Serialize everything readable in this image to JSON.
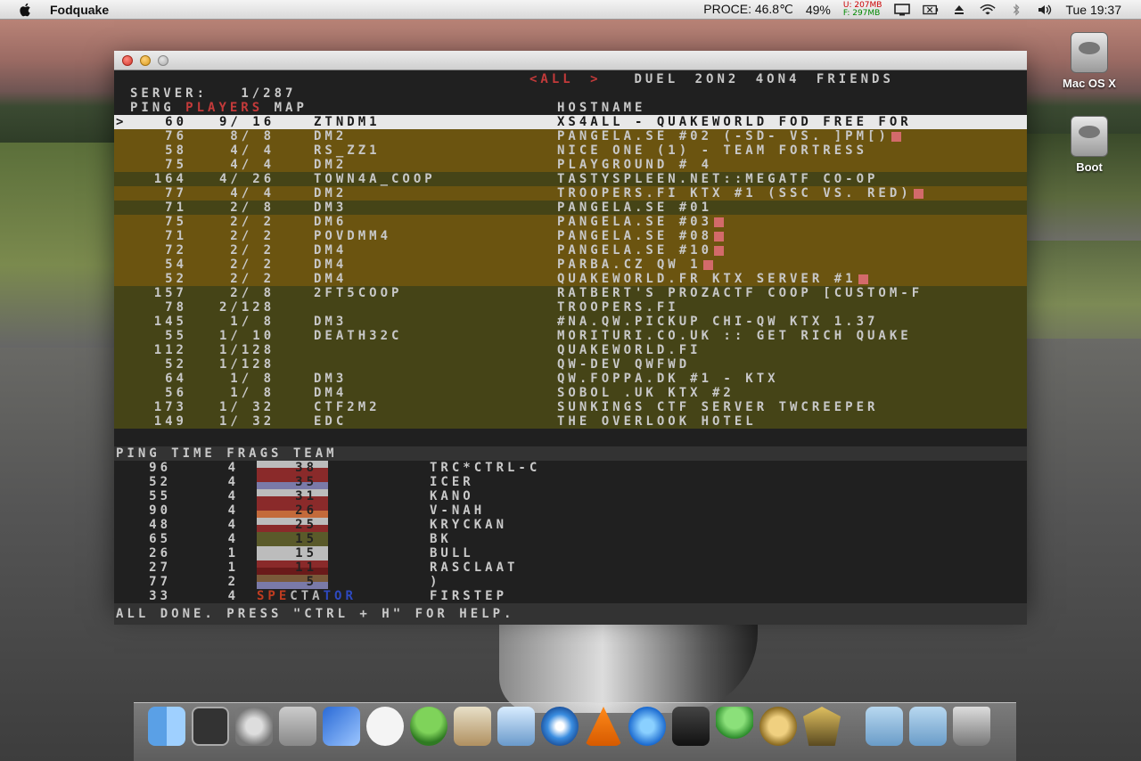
{
  "menubar": {
    "app_name": "Fodquake",
    "cpu": "PROCE: 46.8℃",
    "battery": "49%",
    "mem_used": "U: 207MB",
    "mem_free": "F: 297MB",
    "clock": "Tue 19:37"
  },
  "desktop": {
    "icons": [
      {
        "label": "Mac OS X"
      },
      {
        "label": "Boot"
      }
    ]
  },
  "browser": {
    "tabs": [
      "<ALL >",
      "DUEL",
      "2ON2",
      "4ON4",
      "FRIENDS"
    ],
    "server_label": "SERVER:",
    "server_count": "1/287",
    "headers": {
      "ping": "PING",
      "players": "PLAYERS",
      "map": "MAP",
      "hostname": "HOSTNAME"
    },
    "servers": [
      {
        "ping": "60",
        "players": "9/ 16",
        "map": "ZTNDM1",
        "host": "XS4ALL - QuakeWorld FOD Free For",
        "flag": false,
        "style": "sel"
      },
      {
        "ping": "76",
        "players": "8/ 8",
        "map": "DM2",
        "host": "pangela.se #02 (-sd- vs. ]pm[)",
        "flag": true,
        "style": "bg-y"
      },
      {
        "ping": "58",
        "players": "4/ 4",
        "map": "RS_ZZ1",
        "host": "Nice One (1) - Team Fortress",
        "flag": false,
        "style": "bg-y"
      },
      {
        "ping": "75",
        "players": "4/ 4",
        "map": "DM2",
        "host": "PlayGround # 4",
        "flag": false,
        "style": "bg-y"
      },
      {
        "ping": "164",
        "players": "4/ 26",
        "map": "TOWN4A_COOP",
        "host": "tastyspleen.net::MegaTF Co-Op",
        "flag": false,
        "style": "bg-o"
      },
      {
        "ping": "77",
        "players": "4/ 4",
        "map": "DM2",
        "host": "Troopers.fi KTX #1 (ssc vs. red)",
        "flag": true,
        "style": "bg-y"
      },
      {
        "ping": "71",
        "players": "2/ 8",
        "map": "DM3",
        "host": "pangela.se #01",
        "flag": false,
        "style": "bg-o"
      },
      {
        "ping": "75",
        "players": "2/ 2",
        "map": "DM6",
        "host": "pangela.se #03",
        "flag": true,
        "style": "bg-y"
      },
      {
        "ping": "71",
        "players": "2/ 2",
        "map": "POVDMM4",
        "host": "pangela.se #08",
        "flag": true,
        "style": "bg-y"
      },
      {
        "ping": "72",
        "players": "2/ 2",
        "map": "DM4",
        "host": "pangela.se #10",
        "flag": true,
        "style": "bg-y"
      },
      {
        "ping": "54",
        "players": "2/ 2",
        "map": "DM4",
        "host": "Parba.cz QW 1",
        "flag": true,
        "style": "bg-y"
      },
      {
        "ping": "52",
        "players": "2/ 2",
        "map": "DM4",
        "host": "QuakeWorld.fr KTX Server #1",
        "flag": true,
        "style": "bg-y"
      },
      {
        "ping": "157",
        "players": "2/ 8",
        "map": "2FT5COOP",
        "host": "Ratbert's ProZacTF Coop [Custom-F",
        "flag": false,
        "style": "bg-o"
      },
      {
        "ping": "78",
        "players": "2/128",
        "map": "",
        "host": "troopers.fi",
        "flag": false,
        "style": "bg-o"
      },
      {
        "ping": "145",
        "players": "1/ 8",
        "map": "DM3",
        "host": "#NA.QW.PICKUP CHI-QW KTX 1.37",
        "flag": false,
        "style": "bg-o"
      },
      {
        "ping": "55",
        "players": "1/ 10",
        "map": "DEATH32C",
        "host": "Moriturі.co.uk :: Get Rich Quake",
        "flag": false,
        "style": "bg-o"
      },
      {
        "ping": "112",
        "players": "1/128",
        "map": "",
        "host": "quakeworld.fi",
        "flag": false,
        "style": "bg-o"
      },
      {
        "ping": "52",
        "players": "1/128",
        "map": "",
        "host": "QW-DEV QWFWD",
        "flag": false,
        "style": "bg-o"
      },
      {
        "ping": "64",
        "players": "1/ 8",
        "map": "DM3",
        "host": "qw.foppa.dk #1 - ktx",
        "flag": false,
        "style": "bg-o"
      },
      {
        "ping": "56",
        "players": "1/ 8",
        "map": "DM4",
        "host": "Sobol .UK KTX #2",
        "flag": false,
        "style": "bg-o"
      },
      {
        "ping": "173",
        "players": "1/ 32",
        "map": "CTF2M2",
        "host": "Sunkings CTF Server TWCreeper",
        "flag": false,
        "style": "bg-o"
      },
      {
        "ping": "149",
        "players": "1/ 32",
        "map": "EDC",
        "host": "The Overlook Hotel",
        "flag": false,
        "style": "bg-o"
      }
    ],
    "player_headers": "PING TIME FRAGS TEAM",
    "players": [
      {
        "ping": "96",
        "time": "4",
        "frags": "38",
        "name": "TRC*Ctrl-C",
        "top": "#bcbcbc",
        "bot": "#8a2a2a"
      },
      {
        "ping": "52",
        "time": "4",
        "frags": "35",
        "name": "icer",
        "top": "#8a2a2a",
        "bot": "#7a7aa8"
      },
      {
        "ping": "55",
        "time": "4",
        "frags": "31",
        "name": "kano",
        "top": "#bcbcbc",
        "bot": "#8a2a2a"
      },
      {
        "ping": "90",
        "time": "4",
        "frags": "26",
        "name": "V-nah",
        "top": "#8a2a2a",
        "bot": "#c36a3a"
      },
      {
        "ping": "48",
        "time": "4",
        "frags": "25",
        "name": "kryckan",
        "top": "#bcbcbc",
        "bot": "#8a2a2a"
      },
      {
        "ping": "65",
        "time": "4",
        "frags": "15",
        "name": "bk",
        "top": "#5a5a2a",
        "bot": "#5a5a2a"
      },
      {
        "ping": "26",
        "time": "1",
        "frags": "15",
        "name": "bull",
        "top": "#bcbcbc",
        "bot": "#bcbcbc"
      },
      {
        "ping": "27",
        "time": "1",
        "frags": "11",
        "name": "rasclaat",
        "top": "#8a2a2a",
        "bot": "#6a1a1a"
      },
      {
        "ping": "77",
        "time": "2",
        "frags": "5",
        "name": ")",
        "top": "#7a5a3a",
        "bot": "#7a7aa8"
      }
    ],
    "spectator": {
      "ping": "33",
      "time": "4",
      "label_a": "SPE",
      "label_b": "CTA",
      "label_c": "TOR",
      "name": "firstep"
    },
    "status": "All done. Press \"Ctrl + h\" for help."
  }
}
